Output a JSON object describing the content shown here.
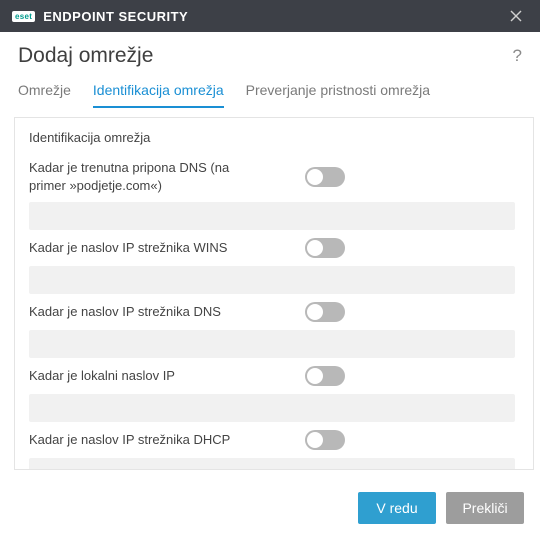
{
  "titlebar": {
    "brand": "eset",
    "product": "ENDPOINT SECURITY"
  },
  "header": {
    "title": "Dodaj omrežje",
    "help": "?"
  },
  "tabs": [
    {
      "label": "Omrežje",
      "active": false
    },
    {
      "label": "Identifikacija omrežja",
      "active": true
    },
    {
      "label": "Preverjanje pristnosti omrežja",
      "active": false
    }
  ],
  "section_title": "Identifikacija omrežja",
  "rows": [
    {
      "label": "Kadar je trenutna pripona DNS (na primer »podjetje.com«)",
      "value": "",
      "on": false
    },
    {
      "label": "Kadar je naslov IP strežnika WINS",
      "value": "",
      "on": false
    },
    {
      "label": "Kadar je naslov IP strežnika DNS",
      "value": "",
      "on": false
    },
    {
      "label": "Kadar je lokalni naslov IP",
      "value": "",
      "on": false
    },
    {
      "label": "Kadar je naslov IP strežnika DHCP",
      "value": "",
      "on": false
    },
    {
      "label": "",
      "value": "",
      "on": false
    }
  ],
  "footer": {
    "ok": "V redu",
    "cancel": "Prekliči"
  }
}
